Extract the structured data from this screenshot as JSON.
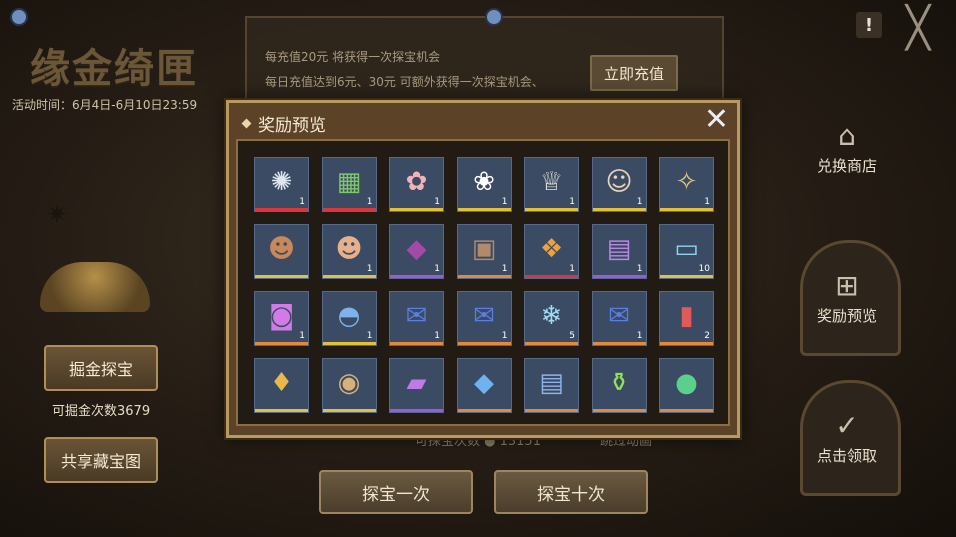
{
  "background": {
    "title": "缘金绮匣",
    "event_time": "活动时间：6月4日-6月10日23:59",
    "info_lines": [
      "每充值20元 将获得一次探宝机会",
      "每日充值达到6元、30元 可额外获得一次探宝机会、"
    ],
    "recharge_label": "立即充值",
    "exclaim": "!",
    "close_glyph": "╳",
    "exchange_shop": "兑换商店",
    "reward_preview": "奖励预览",
    "claim": "点击领取",
    "dig_button": "掘金探宝",
    "dig_count": "可掘金次数3679",
    "share_button": "共享藏宝图",
    "explore_once": "探宝一次",
    "explore_ten": "探宝十次",
    "bg_count": "可探宝次数 ● 13151",
    "bg_check": "跳过动画"
  },
  "modal": {
    "title": "奖励预览",
    "close_glyph": "✕",
    "items": [
      {
        "icon": "✺",
        "name": "silver-emblem-icon",
        "qty": "1",
        "rarity": "#d9363e",
        "color": "#dfe6f0"
      },
      {
        "icon": "▦",
        "name": "garden-scene-icon",
        "qty": "1",
        "rarity": "#d9363e",
        "color": "#7fc76b"
      },
      {
        "icon": "✿",
        "name": "bow-hair-clips-icon",
        "qty": "1",
        "rarity": "#e2c13a",
        "color": "#f2b3b8"
      },
      {
        "icon": "❀",
        "name": "bunny-mask-icon",
        "qty": "1",
        "rarity": "#e2c13a",
        "color": "#ffffff"
      },
      {
        "icon": "♕",
        "name": "white-outfit-icon",
        "qty": "1",
        "rarity": "#e2c13a",
        "color": "#e8e4d8"
      },
      {
        "icon": "☺",
        "name": "blonde-hairstyle-icon",
        "qty": "1",
        "rarity": "#e2c13a",
        "color": "#e9d2b5"
      },
      {
        "icon": "✧",
        "name": "sparkle-accessory-icon",
        "qty": "1",
        "rarity": "#e2c13a",
        "color": "#e8c77a"
      },
      {
        "icon": "☻",
        "name": "brown-hair-portrait-icon",
        "qty": "",
        "rarity": "#e2c13a",
        "color": "#c9885a"
      },
      {
        "icon": "☻",
        "name": "girl-portrait-icon",
        "qty": "1",
        "rarity": "#e2c13a",
        "color": "#e7b08a"
      },
      {
        "icon": "◆",
        "name": "purple-pouch-icon",
        "qty": "1",
        "rarity": "#9b5bd6",
        "color": "#a24aa6"
      },
      {
        "icon": "▣",
        "name": "wooden-crate-icon",
        "qty": "1",
        "rarity": "#e28a3a",
        "color": "#b08a6b"
      },
      {
        "icon": "❖",
        "name": "gift-cube-icon",
        "qty": "1",
        "rarity": "#d9363e",
        "color": "#f0a13a"
      },
      {
        "icon": "▤",
        "name": "purple-chest-icon",
        "qty": "1",
        "rarity": "#9b5bd6",
        "color": "#b58ae0"
      },
      {
        "icon": "▭",
        "name": "blue-ticket-icon",
        "qty": "10",
        "rarity": "#e2c13a",
        "color": "#8fd3f0"
      },
      {
        "icon": "◙",
        "name": "purple-core-box-icon",
        "qty": "1",
        "rarity": "#e28a3a",
        "color": "#d27ae8"
      },
      {
        "icon": "◓",
        "name": "star-helmet-icon",
        "qty": "1",
        "rarity": "#e2c13a",
        "color": "#7fb2e8"
      },
      {
        "icon": "✉",
        "name": "blue-gift-box-icon",
        "qty": "1",
        "rarity": "#e28a3a",
        "color": "#5a7ee0"
      },
      {
        "icon": "✉",
        "name": "blue-gift-box-icon",
        "qty": "1",
        "rarity": "#e28a3a",
        "color": "#5a7ee0"
      },
      {
        "icon": "❄",
        "name": "snow-ticket-icon",
        "qty": "5",
        "rarity": "#e28a3a",
        "color": "#9fdcf5"
      },
      {
        "icon": "✉",
        "name": "blue-gift-box-icon",
        "qty": "1",
        "rarity": "#e28a3a",
        "color": "#5a7ee0"
      },
      {
        "icon": "▮",
        "name": "red-bottle-icon",
        "qty": "2",
        "rarity": "#e28a3a",
        "color": "#e05a5a"
      },
      {
        "icon": "♦",
        "name": "gold-crystal-icon",
        "qty": "",
        "rarity": "#e2c13a",
        "color": "#e8b84a"
      },
      {
        "icon": "◉",
        "name": "orb-icon",
        "qty": "",
        "rarity": "#e2c13a",
        "color": "#d9b07a"
      },
      {
        "icon": "▰",
        "name": "purple-gem-icon",
        "qty": "",
        "rarity": "#9b5bd6",
        "color": "#c07ae8"
      },
      {
        "icon": "◆",
        "name": "blue-crystal-icon",
        "qty": "",
        "rarity": "#e28a3a",
        "color": "#6fb2f0"
      },
      {
        "icon": "▤",
        "name": "blue-chest-icon",
        "qty": "",
        "rarity": "#e28a3a",
        "color": "#8fb2e8"
      },
      {
        "icon": "⚱",
        "name": "green-potion-icon",
        "qty": "",
        "rarity": "#e28a3a",
        "color": "#8fe05a"
      },
      {
        "icon": "●",
        "name": "green-orb-icon",
        "qty": "",
        "rarity": "#e28a3a",
        "color": "#5ad08a"
      }
    ]
  }
}
